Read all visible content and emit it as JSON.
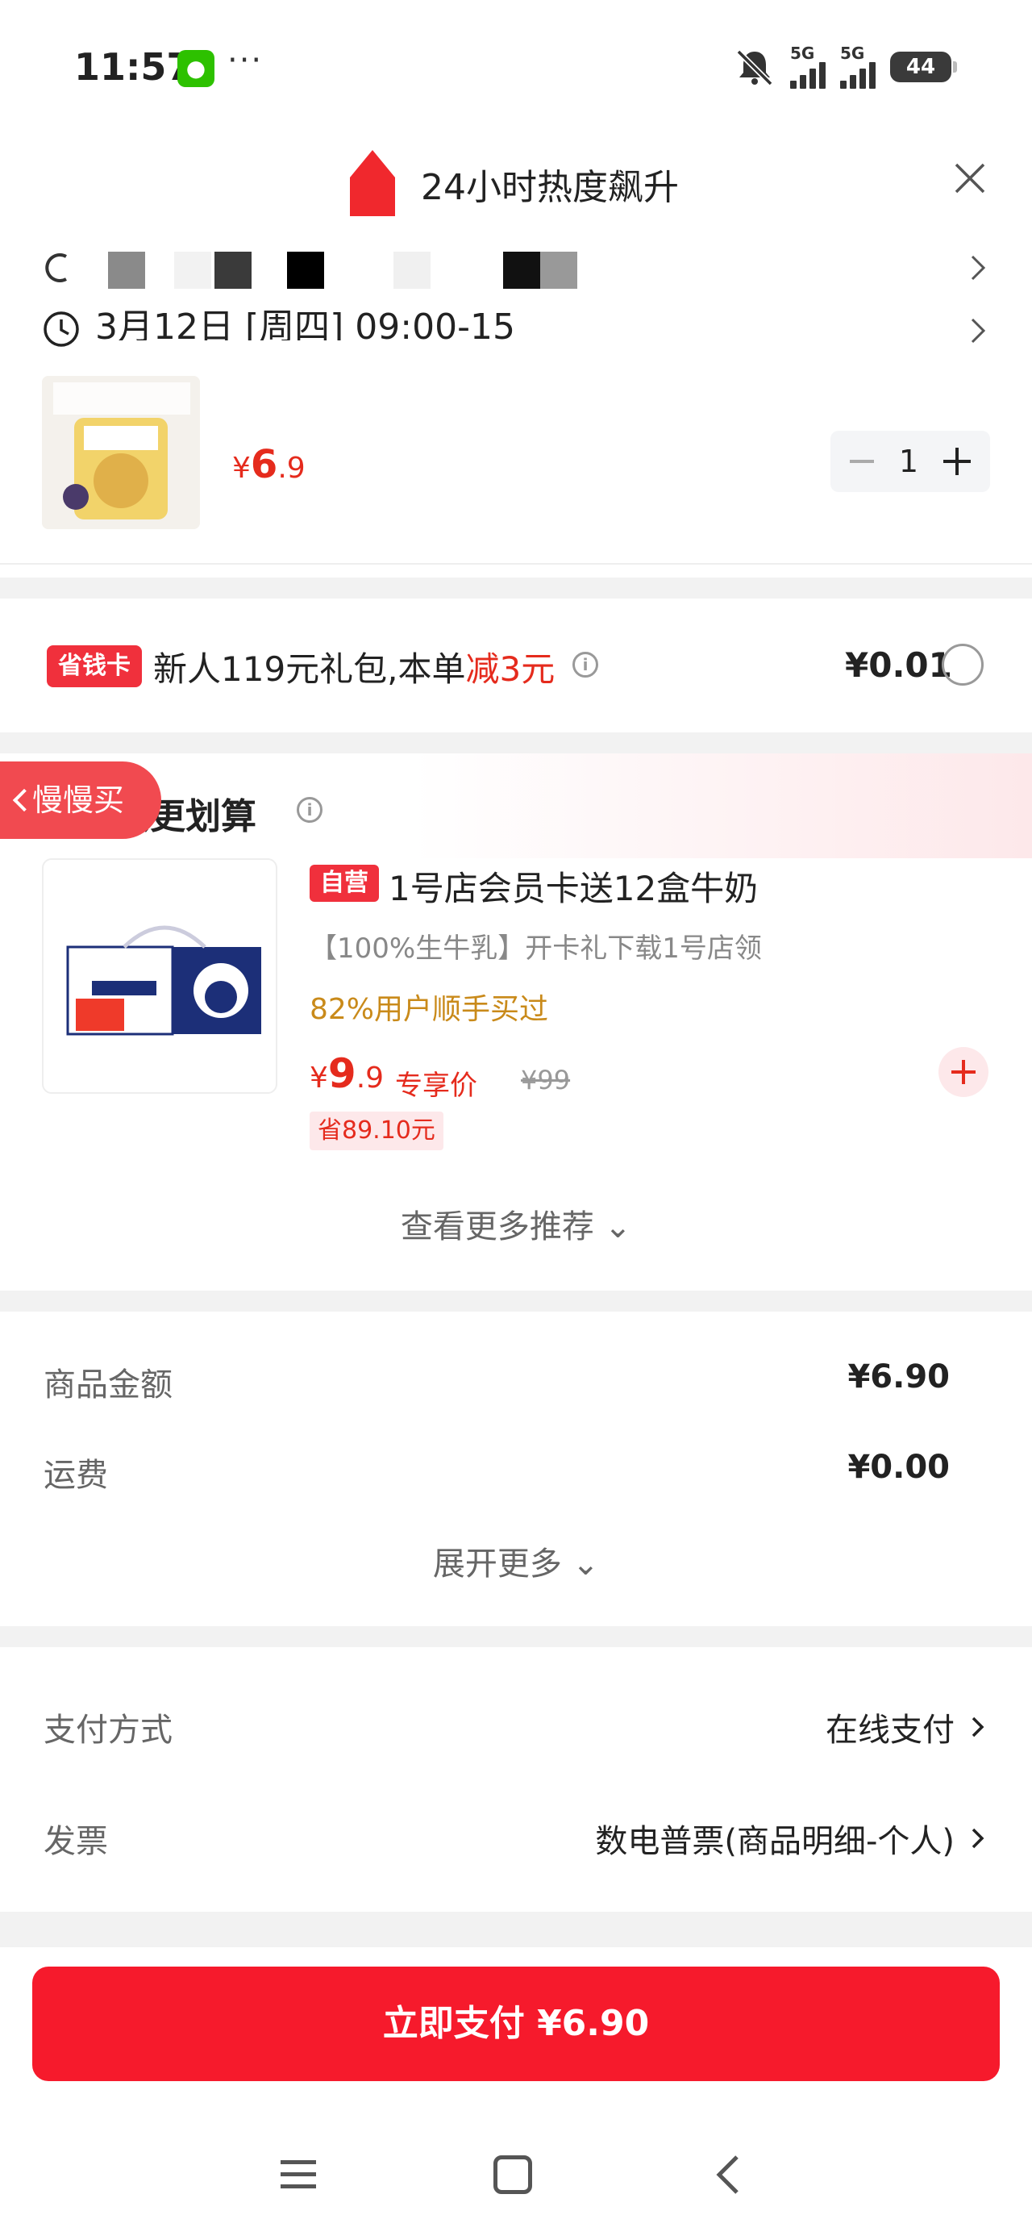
{
  "status_bar": {
    "time": "11:57",
    "dots": "···",
    "sig1": "5G",
    "sig2": "5G",
    "battery": "44"
  },
  "header": {
    "title": "24小时热度飙升"
  },
  "delivery": {
    "time_text": "3月12日 [周四] 09:00-15"
  },
  "product": {
    "price_symbol": "¥",
    "price_int": "6",
    "price_dec": ".9",
    "quantity": "1"
  },
  "coupon": {
    "badge": "省钱卡",
    "text_prefix": "新人119元礼包,本单",
    "text_highlight": "减3元",
    "info": "i",
    "price": "¥0.01"
  },
  "recommend": {
    "title": "顺手买更划算",
    "info": "i",
    "slow_tab": "慢慢买",
    "item": {
      "badge": "自营",
      "title": "1号店会员卡送12盒牛奶",
      "subtitle": "【100%生牛乳】开卡礼下载1号店领",
      "users": "82%用户顺手买过",
      "price_symbol": "¥",
      "price_int": "9",
      "price_dec": ".9",
      "member_label": "专享价",
      "orig_price": "¥99",
      "save": "省89.10元"
    },
    "more": "查看更多推荐 ⌄"
  },
  "summary": {
    "goods_label": "商品金额",
    "goods_value": "¥6.90",
    "shipping_label": "运费",
    "shipping_value": "¥0.00",
    "expand": "展开更多 ⌄"
  },
  "options": {
    "payment_label": "支付方式",
    "payment_value": "在线支付",
    "invoice_label": "发票",
    "invoice_value": "数电普票(商品明细-个人)"
  },
  "pay_button": "立即支付 ¥6.90",
  "colors": {
    "accent": "#f61a2c",
    "price": "#e52b1d",
    "gold": "#c98a1a",
    "divider": "#f2f2f2"
  }
}
